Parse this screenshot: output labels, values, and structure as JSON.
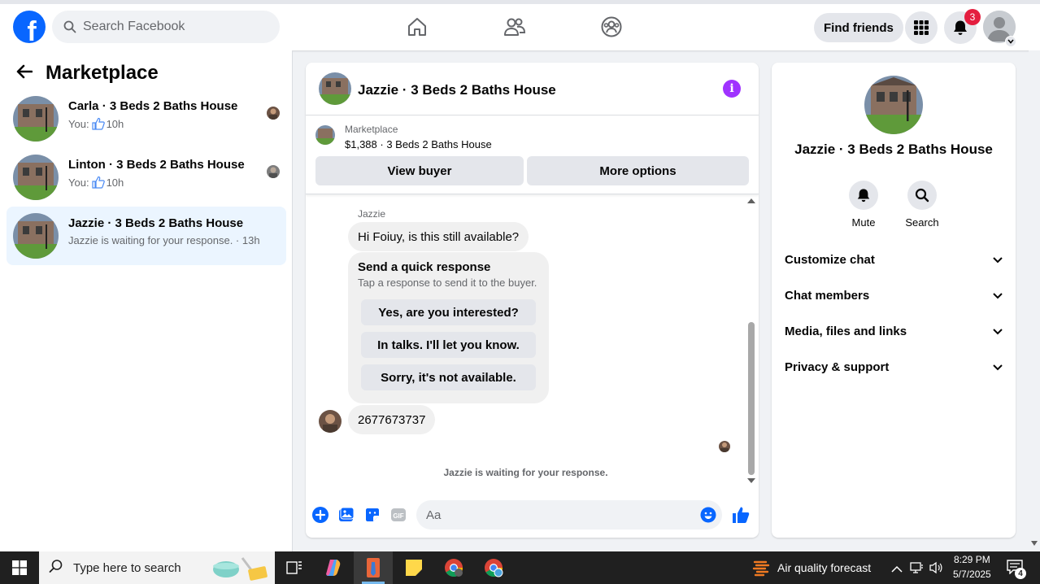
{
  "topbar": {
    "logo_letter": "f",
    "search_placeholder": "Search Facebook",
    "find_friends_label": "Find friends",
    "notification_count": "3"
  },
  "left_panel": {
    "title": "Marketplace",
    "conversations": [
      {
        "name": "Carla · 3 Beds 2 Baths House",
        "prefix": "You:",
        "time": "10h",
        "icon": "thumbs-up-icon"
      },
      {
        "name": "Linton · 3 Beds 2 Baths House",
        "prefix": "You:",
        "time": "10h",
        "icon": "thumbs-up-icon"
      },
      {
        "name": "Jazzie · 3 Beds 2 Baths House",
        "preview": "Jazzie is waiting for your response. · 13h"
      }
    ]
  },
  "chat": {
    "title": "Jazzie · 3 Beds 2 Baths House",
    "info_glyph": "i",
    "listing": {
      "category": "Marketplace",
      "price_title": "$1,388 · 3 Beds 2 Baths House",
      "view_buyer_label": "View buyer",
      "more_options_label": "More options"
    },
    "sender": "Jazzie",
    "message_1": "Hi Foiuy, is this still available?",
    "quick_response": {
      "title": "Send a quick response",
      "subtitle": "Tap a response to send it to the buyer.",
      "options": [
        "Yes, are you interested?",
        "In talks. I'll let you know.",
        "Sorry, it's not available."
      ]
    },
    "message_2": "2677673737",
    "status": "Jazzie is waiting for your response.",
    "composer_placeholder": "Aa"
  },
  "right_panel": {
    "title": "Jazzie · 3 Beds 2 Baths House",
    "actions": [
      {
        "label": "Mute",
        "icon": "bell-icon"
      },
      {
        "label": "Search",
        "icon": "search-icon"
      }
    ],
    "sections": [
      "Customize chat",
      "Chat members",
      "Media, files and links",
      "Privacy & support"
    ]
  },
  "taskbar": {
    "search_placeholder": "Type here to search",
    "weather": "Air quality forecast",
    "time": "8:29 PM",
    "date": "5/7/2025",
    "notification_count": "4"
  },
  "colors": {
    "brand": "#0866ff",
    "info": "#a033ff",
    "badge": "#e41e3f"
  }
}
